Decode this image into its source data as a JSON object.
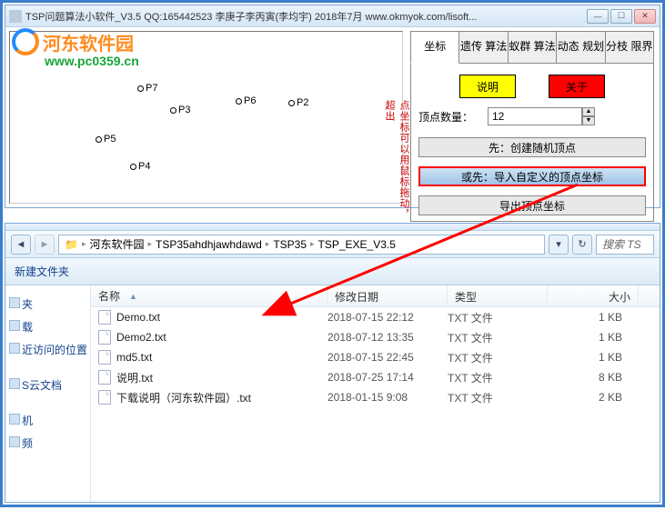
{
  "top_window": {
    "title": "TSP问题算法小软件_V3.5     QQ:165442523 李庚子李丙寅(李均宇)   2018年7月    www.okmyok.com/lisoft...",
    "tabs": [
      "坐标",
      "遗传\n算法",
      "蚁群\n算法",
      "动态\n规划",
      "分枝\n限界"
    ],
    "side_vert": "点坐标可以用鼠标拖动，超出",
    "btn_explain": "说明",
    "btn_about": "关于",
    "vertex_count_label": "顶点数量：",
    "vertex_count_value": "12",
    "btn_create_random": "先：创建随机顶点",
    "btn_import_custom": "或先：导入自定义的顶点坐标",
    "btn_export": "导出顶点坐标",
    "points": {
      "p2": "P2",
      "p3": "P3",
      "p4": "P4",
      "p5": "P5",
      "p6": "P6",
      "p7": "P7"
    }
  },
  "explorer": {
    "breadcrumb": [
      "河东软件园",
      "TSP35ahdhjawhdawd",
      "TSP35",
      "TSP_EXE_V3.5"
    ],
    "search_placeholder": "搜索 TS",
    "toolbar_new_folder": "新建文件夹",
    "headers": {
      "name": "名称",
      "date": "修改日期",
      "type": "类型",
      "size": "大小"
    },
    "nav_items": [
      "夹",
      "载",
      "近访问的位置",
      "S云文档",
      "机",
      "频"
    ],
    "files": [
      {
        "name": "Demo.txt",
        "date": "2018-07-15 22:12",
        "type": "TXT 文件",
        "size": "1 KB"
      },
      {
        "name": "Demo2.txt",
        "date": "2018-07-12 13:35",
        "type": "TXT 文件",
        "size": "1 KB"
      },
      {
        "name": "md5.txt",
        "date": "2018-07-15 22:45",
        "type": "TXT 文件",
        "size": "1 KB"
      },
      {
        "name": "说明.txt",
        "date": "2018-07-25 17:14",
        "type": "TXT 文件",
        "size": "8 KB"
      },
      {
        "name": "下载说明（河东软件园）.txt",
        "date": "2018-01-15 9:08",
        "type": "TXT 文件",
        "size": "2 KB"
      }
    ]
  },
  "watermark": {
    "brand": "河东软件园",
    "url": "www.pc0359.cn"
  }
}
